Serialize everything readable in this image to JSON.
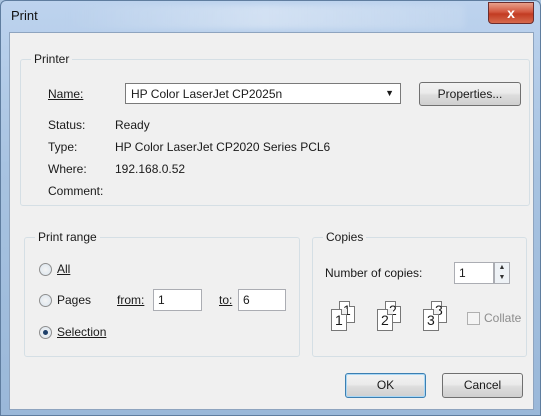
{
  "window": {
    "title": "Print",
    "close_symbol": "x"
  },
  "printer": {
    "group_title": "Printer",
    "name_label": "Name:",
    "name_value": "HP Color LaserJet CP2025n",
    "properties_label": "Properties...",
    "status_label": "Status:",
    "status_value": "Ready",
    "type_label": "Type:",
    "type_value": "HP Color LaserJet CP2020 Series PCL6",
    "where_label": "Where:",
    "where_value": "192.168.0.52",
    "comment_label": "Comment:"
  },
  "print_range": {
    "group_title": "Print range",
    "all_label": "All",
    "pages_label": "Pages",
    "from_label": "from:",
    "from_value": "1",
    "to_label": "to:",
    "to_value": "6",
    "selection_label": "Selection",
    "selected": "selection"
  },
  "copies": {
    "group_title": "Copies",
    "number_label": "Number of copies:",
    "number_value": "1",
    "collate_label": "Collate",
    "collate_checked": false,
    "collate_enabled": false,
    "collate_pages": [
      "1",
      "1",
      "2",
      "2",
      "3",
      "3"
    ]
  },
  "buttons": {
    "ok": "OK",
    "cancel": "Cancel"
  },
  "colors": {
    "window_frame": "#a8c3e1",
    "dialog_bg": "#f0f0f0",
    "close_button": "#c23b22"
  }
}
